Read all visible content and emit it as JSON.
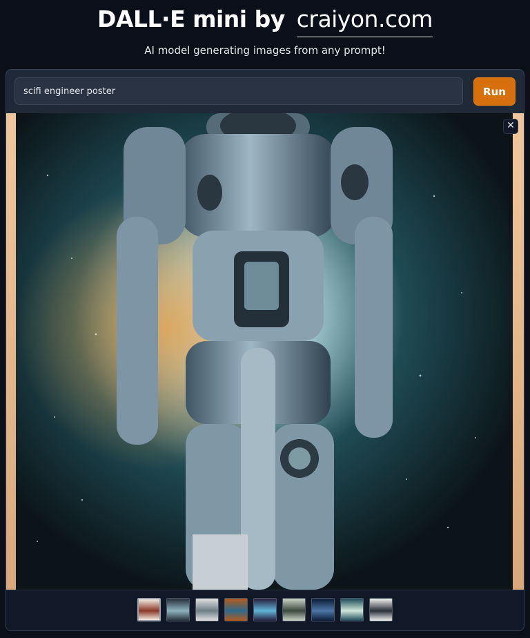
{
  "header": {
    "title": "DALL·E mini by",
    "title_link": "craiyon.com",
    "subtitle": "AI model generating images from any prompt!"
  },
  "prompt": {
    "value": "scifi engineer poster",
    "run_label": "Run"
  },
  "gallery": {
    "close_glyph": "✕",
    "selected_index": 0,
    "thumbnails": [
      {
        "colors": [
          "#f2eae0",
          "#8a3a2a"
        ]
      },
      {
        "colors": [
          "#24303a",
          "#8fb2bd"
        ]
      },
      {
        "colors": [
          "#e0e0e0",
          "#6d7f86"
        ]
      },
      {
        "colors": [
          "#b45a1c",
          "#2e6a8a"
        ]
      },
      {
        "colors": [
          "#271e3f",
          "#5fb4d8"
        ]
      },
      {
        "colors": [
          "#c9d3c6",
          "#3b4a3d"
        ]
      },
      {
        "colors": [
          "#0b1b36",
          "#4d77a6"
        ]
      },
      {
        "colors": [
          "#1d4a58",
          "#cfe6da"
        ]
      },
      {
        "colors": [
          "#f0f0f0",
          "#2a2f38"
        ]
      }
    ]
  },
  "colors": {
    "accent": "#d5700c",
    "background": "#0b0f19",
    "panel": "#1f2937"
  }
}
